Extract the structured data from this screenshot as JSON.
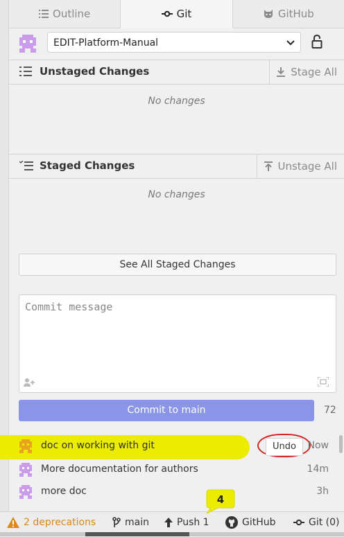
{
  "tabs": [
    {
      "label": "Outline",
      "icon": "list-icon"
    },
    {
      "label": "Git",
      "icon": "git-commit-icon"
    },
    {
      "label": "GitHub",
      "icon": "octocat-icon"
    }
  ],
  "repo": {
    "name": "EDIT-Platform-Manual"
  },
  "unstaged": {
    "title": "Unstaged Changes",
    "action": "Stage All",
    "empty": "No changes"
  },
  "staged": {
    "title": "Staged Changes",
    "action": "Unstage All",
    "empty": "No changes"
  },
  "see_all": "See All Staged Changes",
  "commit": {
    "placeholder": "Commit message",
    "button": "Commit to main",
    "remaining": "72"
  },
  "commits": [
    {
      "message": "doc on working with git",
      "time": "Now",
      "undo": "Undo"
    },
    {
      "message": "More documentation for authors",
      "time": "14m"
    },
    {
      "message": "more doc",
      "time": "3h"
    }
  ],
  "status": {
    "deprecations": "2 deprecations",
    "branch": "main",
    "push": "Push 1",
    "github": "GitHub",
    "git": "Git (0)"
  },
  "annotation": {
    "badge": "4"
  },
  "colors": {
    "accent": "#8b95e8",
    "highlight": "#ecec00",
    "ring": "#d62222",
    "warning": "#d98a18",
    "avatar": "#c99be8",
    "avatar_active": "#e8a41c"
  }
}
